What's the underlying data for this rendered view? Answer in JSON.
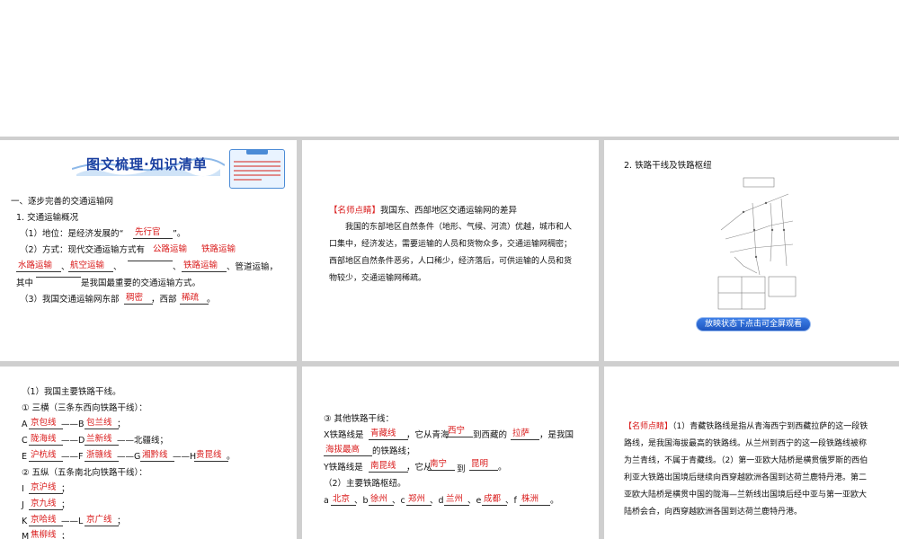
{
  "slide1": {
    "title": "图文梳理·知识清单",
    "heading": "一、逐步完善的交通运输网",
    "sec1": "1. 交通运输概况",
    "l1_pre": "（1）地位：是经济发展的“",
    "l1_ans": "先行官",
    "l1_post": "”。",
    "l2_pre": "（2）方式：现代交通运输方式有",
    "l2_a1": "公路运输",
    "l2_a2": "铁路运输",
    "l3_a1": "水路运输",
    "l3_sep1": "、",
    "l3_a2": "航空运输",
    "l3_sep2": "、",
    "l3_sep3": "、",
    "l3_a4": "铁路运输",
    "l3_post": "、管道运输，",
    "l4_pre": "其中",
    "l4_post": "是我国最重要的交通运输方式。",
    "l5_pre": "（3）我国交通运输网东部",
    "l5_a1": "稠密",
    "l5_mid": "，西部",
    "l5_a2": "稀疏",
    "l5_post": "。"
  },
  "slide2": {
    "tag": "【名师点睛】",
    "tag_title": "我国东、西部地区交通运输网的差异",
    "body": "我国的东部地区自然条件（地形、气候、河流）优越，城市和人口集中，经济发达，需要运输的人员和货物众多，交通运输网稠密；西部地区自然条件恶劣，人口稀少，经济落后，可供运输的人员和货物较少，交通运输网稀疏。"
  },
  "slide3": {
    "title": "2. 铁路干线及铁路枢纽",
    "play": "放映状态下点击可全屏观看"
  },
  "slide4": {
    "l1": "（1）我国主要铁路干线。",
    "l2": "① 三横（三条东西向铁路干线）：",
    "r1_a": "A",
    "r1_a1": "京包线",
    "r1_mid": "——B",
    "r1_a2": "包兰线",
    "r1_end": "；",
    "r2_a": "C",
    "r2_a1": "陇海线",
    "r2_mid": "——D",
    "r2_a2": "兰新线",
    "r2_end": "——北疆线；",
    "r3_a": "E",
    "r3_a1": "沪杭线",
    "r3_mid": "——F",
    "r3_a2": "浙赣线",
    "r3_mid2": "——G",
    "r3_a3": "湘黔线",
    "r3_mid3": "——H",
    "r3_a4": "贵昆线",
    "r3_end": "。",
    "l3": "② 五纵（五条南北向铁路干线）：",
    "r4_a": "I",
    "r4_a1": "京沪线",
    "r4_end": "；",
    "r5_a": "J",
    "r5_a1": "京九线",
    "r5_end": "；",
    "r6_a": "K",
    "r6_a1": "京哈线",
    "r6_mid": "——L",
    "r6_a2": "京广线",
    "r6_end": "；",
    "r7_a": "M",
    "r7_a1": "焦柳线",
    "r7_end": "；"
  },
  "slide5": {
    "l1": "③ 其他铁路干线：",
    "r1_pre": "X铁路线是",
    "r1_a1": "青藏线",
    "r1_mid": "，它从青海",
    "r1_a2": "西宁",
    "r1_mid2": "到西藏的",
    "r1_a3": "拉萨",
    "r1_post": "，是我国",
    "r2_a1": "海拔最高",
    "r2_post": "的铁路线；",
    "r3_pre": "Y铁路线是",
    "r3_a1": "南昆线",
    "r3_mid": "，它从",
    "r3_a2": "南宁",
    "r3_mid2": "到",
    "r3_a3": "昆明",
    "r3_post": "。",
    "l2": "（2）主要铁路枢纽。",
    "h_a": "a",
    "h_a1": "北京",
    "h_sep1": "、b",
    "h_a2": "徐州",
    "h_sep2": "、c",
    "h_a3": "郑州",
    "h_sep3": "、d",
    "h_a4": "兰州",
    "h_sep4": "、e",
    "h_a5": "成都",
    "h_sep5": "、f",
    "h_a6": "株洲",
    "h_end": "。"
  },
  "slide6": {
    "tag": "【名师点睛】",
    "body": "（1）青藏铁路线是指从青海西宁到西藏拉萨的这一段铁路线，是我国海拔最高的铁路线。从兰州到西宁的这一段铁路线被称为兰青线，不属于青藏线。（2）第一亚欧大陆桥是横贯俄罗斯的西伯利亚大铁路出国境后继续向西穿越欧洲各国到达荷兰鹿特丹港。第二亚欧大陆桥是横贯中国的陇海—兰新线出国境后经中亚与第一亚欧大陆桥会合，向西穿越欧洲各国到达荷兰鹿特丹港。"
  },
  "colors": {
    "answer": "#d91a1a",
    "title_blue": "#1a3fa0",
    "separator": "#cfcfcf"
  }
}
